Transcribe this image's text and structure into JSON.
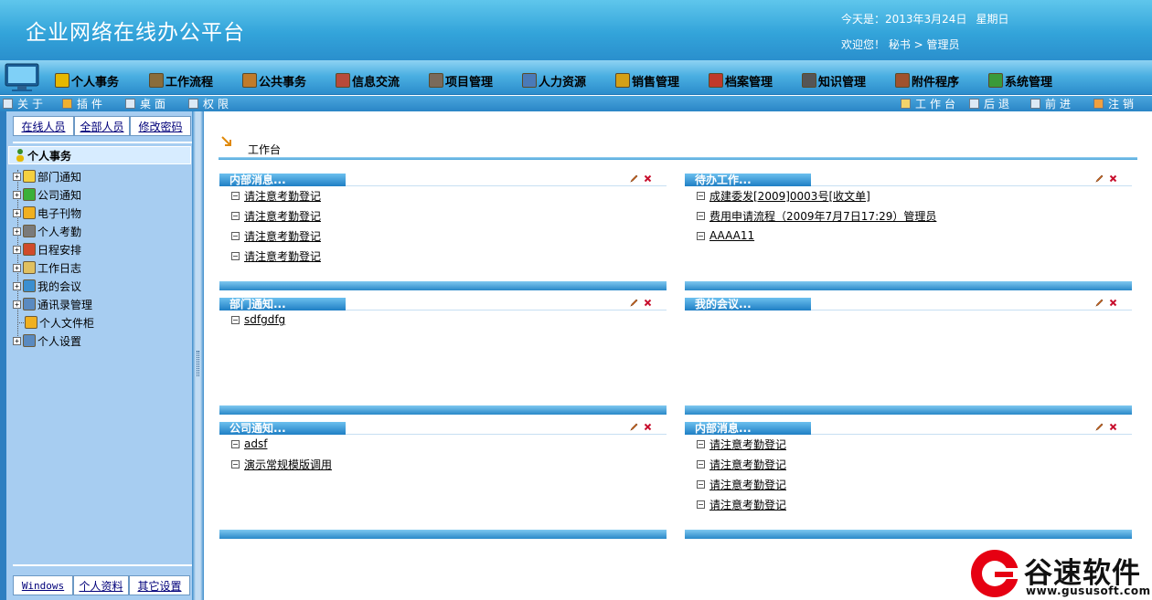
{
  "header": {
    "title": "企业网络在线办公平台",
    "date_line": "今天是：2013年3月24日",
    "weekday": "星期日",
    "welcome_line": "欢迎您！ 秘书 > 管理员"
  },
  "menu": [
    {
      "label": "个人事务",
      "icon": "user-icon"
    },
    {
      "label": "工作流程",
      "icon": "workflow-icon"
    },
    {
      "label": "公共事务",
      "icon": "public-affairs-icon"
    },
    {
      "label": "信息交流",
      "icon": "message-icon"
    },
    {
      "label": "项目管理",
      "icon": "project-icon"
    },
    {
      "label": "人力资源",
      "icon": "hr-icon"
    },
    {
      "label": "销售管理",
      "icon": "sales-icon"
    },
    {
      "label": "档案管理",
      "icon": "archive-icon"
    },
    {
      "label": "知识管理",
      "icon": "knowledge-icon"
    },
    {
      "label": "附件程序",
      "icon": "attachment-icon"
    },
    {
      "label": "系统管理",
      "icon": "system-icon"
    }
  ],
  "toolbar": {
    "left": [
      {
        "label": "关于",
        "icon": "document-icon"
      },
      {
        "label": "插件",
        "icon": "plugin-icon"
      },
      {
        "label": "桌面",
        "icon": "desktop-icon"
      },
      {
        "label": "权限",
        "icon": "permission-icon"
      }
    ],
    "right": [
      {
        "label": "工作台",
        "icon": "home-icon"
      },
      {
        "label": "后退",
        "icon": "back-icon"
      },
      {
        "label": "前进",
        "icon": "forward-icon"
      },
      {
        "label": "注销",
        "icon": "logout-icon"
      }
    ]
  },
  "sidebar": {
    "top_tabs": [
      "在线人员",
      "全部人员",
      "修改密码"
    ],
    "root": "个人事务",
    "items": [
      {
        "label": "部门通知",
        "icon": "speaker-icon",
        "expandable": true
      },
      {
        "label": "公司通知",
        "icon": "star-icon",
        "expandable": true
      },
      {
        "label": "电子刊物",
        "icon": "folder-icon",
        "expandable": true
      },
      {
        "label": "个人考勤",
        "icon": "attendance-icon",
        "expandable": true
      },
      {
        "label": "日程安排",
        "icon": "calendar-icon",
        "expandable": true
      },
      {
        "label": "工作日志",
        "icon": "notepad-icon",
        "expandable": true
      },
      {
        "label": "我的会议",
        "icon": "meeting-icon",
        "expandable": true
      },
      {
        "label": "通讯录管理",
        "icon": "contacts-icon",
        "expandable": true
      },
      {
        "label": "个人文件柜",
        "icon": "folder-icon",
        "expandable": false
      },
      {
        "label": "个人设置",
        "icon": "settings-icon",
        "expandable": true
      }
    ],
    "bottom_tabs": [
      "Windows",
      "个人资料",
      "其它设置"
    ]
  },
  "content": {
    "title": "工作台",
    "panels": [
      {
        "title": "内部消息...",
        "items": [
          "请注意考勤登记",
          "请注意考勤登记",
          "请注意考勤登记",
          "请注意考勤登记"
        ]
      },
      {
        "title": "待办工作...",
        "items": [
          "成建委发[2009]0003号[收文单]",
          "费用申请流程（2009年7月7日17:29）管理员",
          "AAAA11"
        ]
      },
      {
        "title": "部门通知...",
        "items": [
          "sdfgdfg"
        ]
      },
      {
        "title": "我的会议...",
        "items": []
      },
      {
        "title": "公司通知...",
        "items": [
          "adsf",
          "演示常规模版调用"
        ]
      },
      {
        "title": "内部消息...",
        "items": [
          "请注意考勤登记",
          "请注意考勤登记",
          "请注意考勤登记",
          "请注意考勤登记"
        ]
      }
    ]
  },
  "watermark": {
    "brand": "谷速软件",
    "url": "www.gususoft.com"
  },
  "colors": {
    "header_blue": "#33a4da",
    "panel_blue": "#1f7fc4",
    "sidebar_bg": "#a7cdf1",
    "logo_red": "#e60012"
  }
}
